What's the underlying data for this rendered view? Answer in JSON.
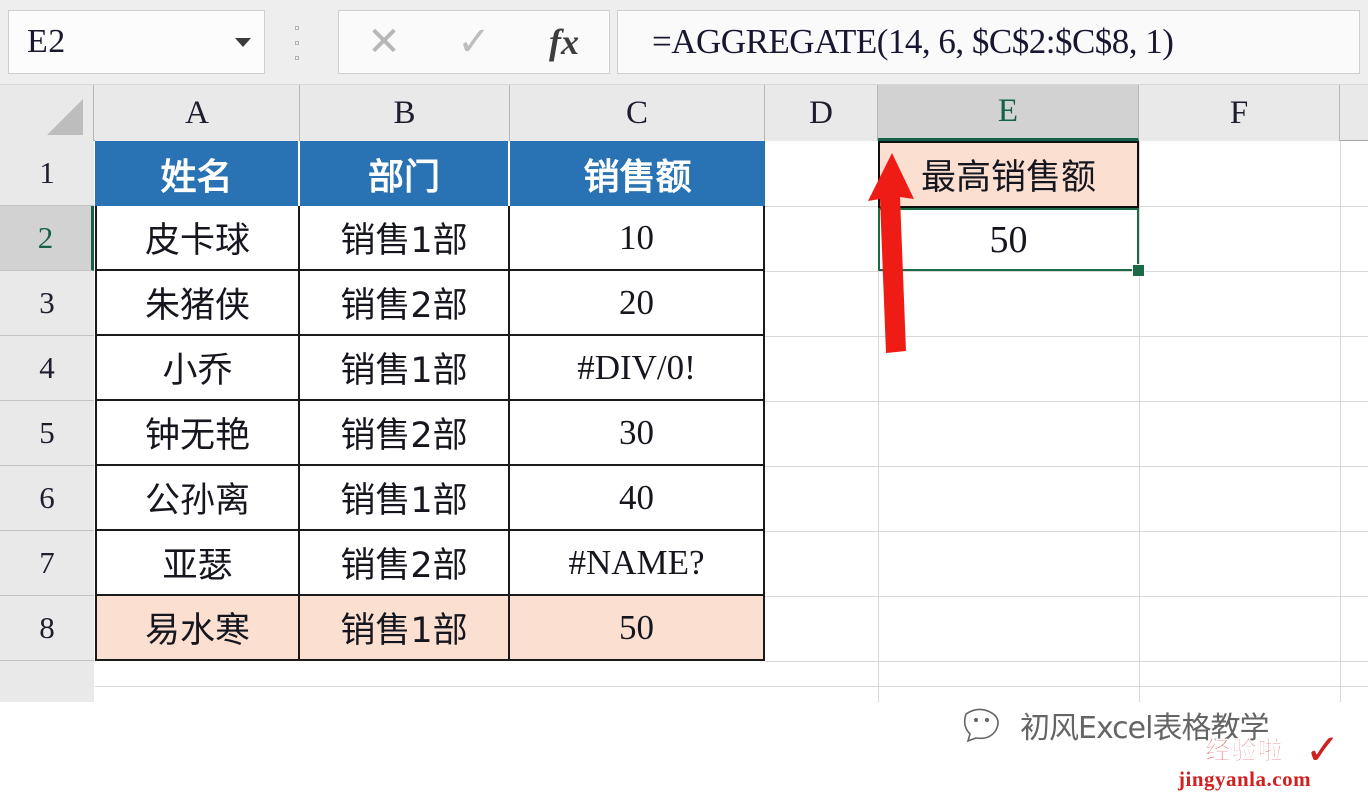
{
  "app": "excel-spreadsheet",
  "formula_bar": {
    "name_box_value": "E2",
    "name_box_dropdown_icon": "chevron-down-icon",
    "cancel_icon": "cancel-x-icon",
    "enter_icon": "enter-check-icon",
    "insert_function_icon": "fx-icon",
    "formula": "=AGGREGATE(14, 6, $C$2:$C$8, 1)"
  },
  "grid": {
    "column_headers": [
      "A",
      "B",
      "C",
      "D",
      "E",
      "F"
    ],
    "selected_column": "E",
    "row_headers": [
      "1",
      "2",
      "3",
      "4",
      "5",
      "6",
      "7",
      "8"
    ],
    "selected_row": "2",
    "select_all_icon": "select-all-triangle-icon",
    "table": {
      "headers": [
        "姓名",
        "部门",
        "销售额"
      ],
      "rows": [
        {
          "name": "皮卡球",
          "dept": "销售1部",
          "sales": "10",
          "highlight": false
        },
        {
          "name": "朱猪侠",
          "dept": "销售2部",
          "sales": "20",
          "highlight": false
        },
        {
          "name": "小乔",
          "dept": "销售1部",
          "sales": "#DIV/0!",
          "highlight": false
        },
        {
          "name": "钟无艳",
          "dept": "销售2部",
          "sales": "30",
          "highlight": false
        },
        {
          "name": "公孙离",
          "dept": "销售1部",
          "sales": "40",
          "highlight": false
        },
        {
          "name": "亚瑟",
          "dept": "销售2部",
          "sales": "#NAME?",
          "highlight": false
        },
        {
          "name": "易水寒",
          "dept": "销售1部",
          "sales": "50",
          "highlight": true
        }
      ]
    },
    "result": {
      "label": "最高销售额",
      "value": "50",
      "label_cell": "E1",
      "value_cell": "E2"
    }
  },
  "annotation": {
    "arrow_icon": "red-up-arrow-icon",
    "arrow_color": "#ee1c15"
  },
  "watermark": {
    "logo_icon": "wechat-smiley-icon",
    "text": "初风Excel表格教学",
    "site_cn": "经验啦",
    "site_url": "jingyanla.com",
    "check_icon": "red-check-icon"
  },
  "colors": {
    "header_blue": "#2973B4",
    "highlight_peach": "#FBDFD0",
    "selection_green": "#1b6b46",
    "arrow_red": "#ee1c15",
    "grid_border": "#1a1a1a"
  }
}
